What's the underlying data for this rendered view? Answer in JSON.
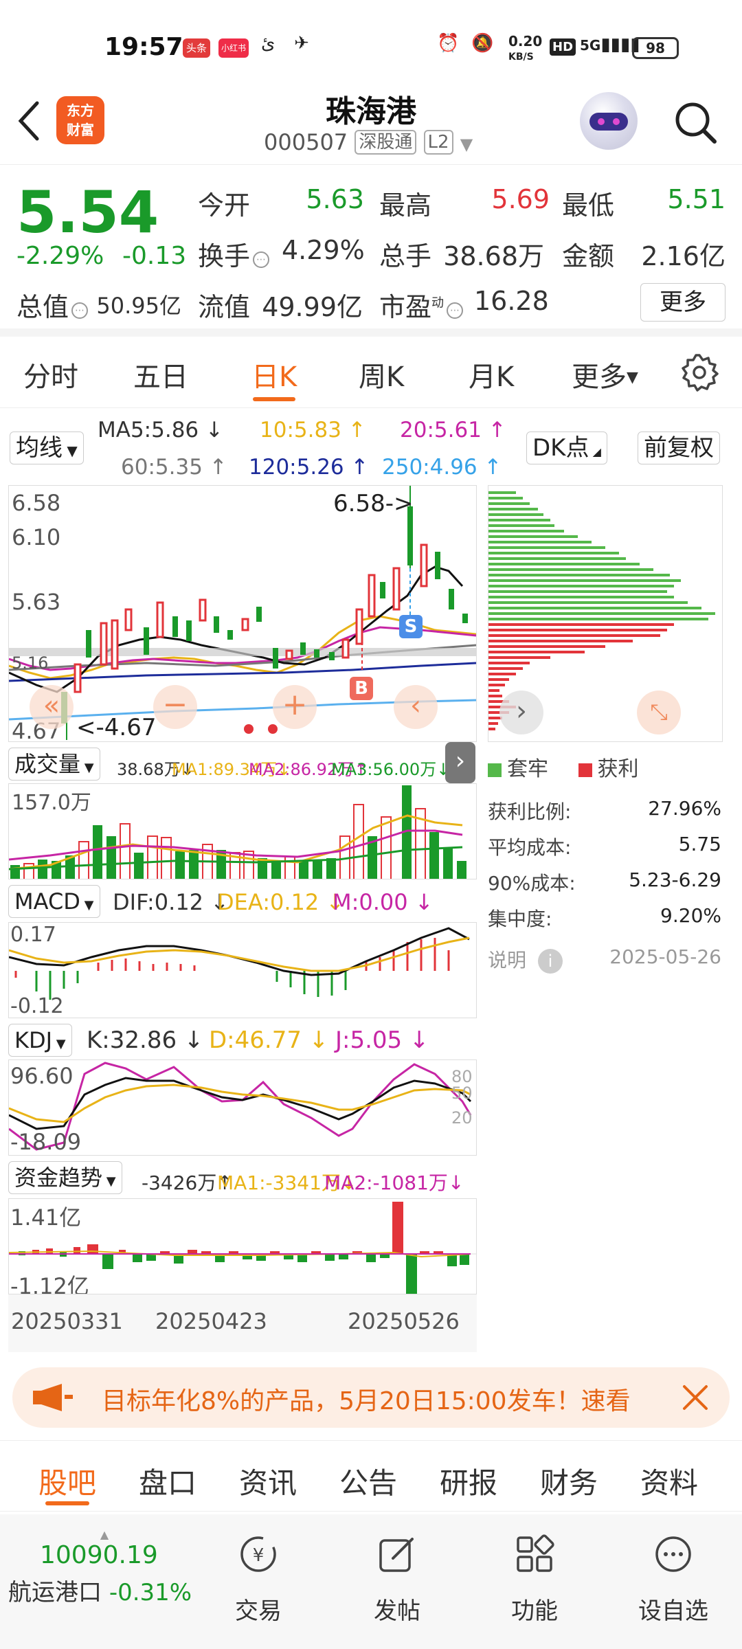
{
  "status_bar": {
    "time": "19:57",
    "apps": [
      "头条",
      "小红书",
      "ئ",
      "✈"
    ],
    "net_speed": "0.20",
    "net_unit": "KB/S",
    "hd": "HD",
    "signal": "5G",
    "battery": "98"
  },
  "header": {
    "back_icon": "chevron-left-icon",
    "logo_text": "东方财富",
    "stock_name": "珠海港",
    "stock_code": "000507",
    "tag_connect": "深股通",
    "tag_level": "L2",
    "assistant_icon": "robot-avatar-icon",
    "search_icon": "search-icon"
  },
  "quote": {
    "price": "5.54",
    "change_pct": "-2.29%",
    "change": "-0.13",
    "open_label": "今开",
    "open": "5.63",
    "high_label": "最高",
    "high": "5.69",
    "low_label": "最低",
    "low": "5.51",
    "turnover_label": "换手",
    "turnover": "4.29%",
    "volume_label": "总手",
    "volume": "38.68万",
    "amount_label": "金额",
    "amount": "2.16亿",
    "total_value_label": "总值",
    "total_value": "50.95亿",
    "float_value_label": "流值",
    "float_value": "49.99亿",
    "pe_label": "市盈",
    "pe_sup": "动",
    "pe": "16.28",
    "more_label": "更多"
  },
  "tabs": {
    "items": [
      "分时",
      "五日",
      "日K",
      "周K",
      "月K",
      "更多"
    ],
    "active": "日K",
    "settings_icon": "gear-icon"
  },
  "ma_bar": {
    "selector": "均线",
    "ma5": "MA5:5.86",
    "ma10": "10:5.83",
    "ma20": "20:5.61",
    "ma60": "60:5.35",
    "ma120": "120:5.26",
    "ma250": "250:4.96",
    "dk_button": "DK点",
    "adjust_button": "前复权"
  },
  "kline": {
    "y_ticks": [
      "6.58",
      "6.10",
      "5.63",
      "5.16",
      "4.67"
    ],
    "high_marker": "6.58->",
    "low_marker": "<-4.67",
    "sell_marker": "S",
    "buy_marker": "B"
  },
  "volume": {
    "selector": "成交量",
    "vol": "38.68万",
    "ma1": "MA1:89.34万",
    "ma2": "MA2:86.92万",
    "ma3": "MA3:56.00万",
    "y_tick": "157.0万"
  },
  "macd": {
    "selector": "MACD",
    "dif": "DIF:0.12",
    "dea": "DEA:0.12",
    "m": "M:0.00",
    "y_top": "0.17",
    "y_bottom": "-0.12"
  },
  "kdj": {
    "selector": "KDJ",
    "k": "K:32.86",
    "d": "D:46.77",
    "j": "J:5.05",
    "y_top": "96.60",
    "y_bottom": "-18.09",
    "right_80": "80",
    "right_50": "50",
    "right_20": "20"
  },
  "capital": {
    "selector": "资金趋势",
    "value": "-3426万",
    "ma1": "MA1:-3341万",
    "ma2": "MA2:-1081万",
    "y_top": "1.41亿",
    "y_bottom": "-1.12亿"
  },
  "dates": [
    "20250331",
    "20250423",
    "20250526"
  ],
  "chip_dist": {
    "legend_trapped": "套牢",
    "legend_profit": "获利",
    "profit_ratio_label": "获利比例:",
    "profit_ratio": "27.96%",
    "avg_cost_label": "平均成本:",
    "avg_cost": "5.75",
    "cost90_label": "90%成本:",
    "cost90": "5.23-6.29",
    "concentration_label": "集中度:",
    "concentration": "9.20%",
    "note_label": "说明",
    "date": "2025-05-26"
  },
  "banner": {
    "text": "目标年化8%的产品，5月20日15:00发车！速看",
    "close_icon": "close-icon"
  },
  "bottom_tabs": {
    "items": [
      "股吧",
      "盘口",
      "资讯",
      "公告",
      "研报",
      "财务",
      "资料"
    ],
    "active": "股吧"
  },
  "bottom_bar": {
    "index_value": "10090.19",
    "index_name": "航运港口",
    "index_change": "-0.31%",
    "trade": "交易",
    "post": "发帖",
    "function": "功能",
    "watch": "设自选"
  },
  "colors": {
    "up": "#e2343a",
    "down": "#1a9a2a",
    "accent": "#f26a1b"
  }
}
